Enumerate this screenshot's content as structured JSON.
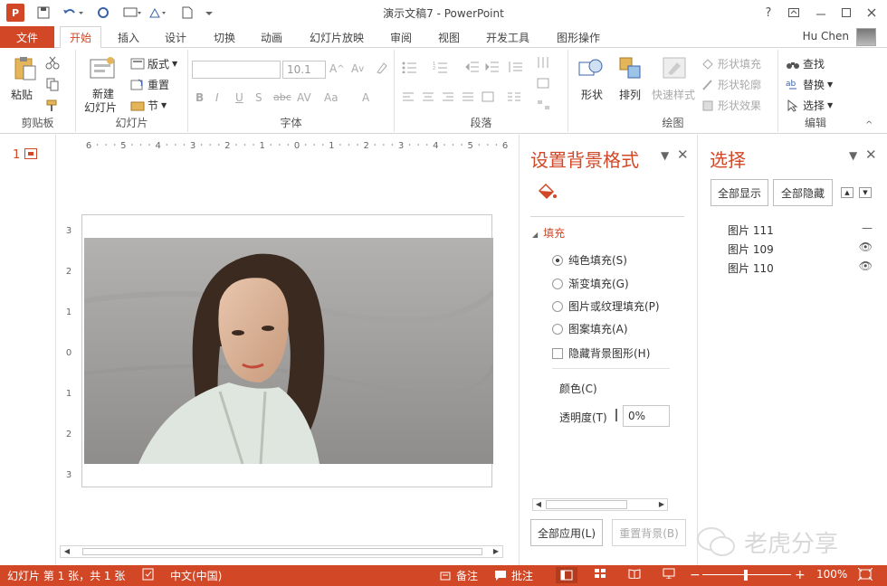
{
  "window": {
    "title": "演示文稿7 - PowerPoint",
    "app_logo": "P",
    "help": "?",
    "user_name": "Hu Chen"
  },
  "tabs": {
    "file": "文件",
    "items": [
      "开始",
      "插入",
      "设计",
      "切换",
      "动画",
      "幻灯片放映",
      "审阅",
      "视图",
      "开发工具",
      "图形操作"
    ],
    "active": "开始"
  },
  "ribbon": {
    "clipboard": {
      "label": "剪贴板",
      "paste": "粘贴"
    },
    "slides": {
      "label": "幻灯片",
      "new_slide_line1": "新建",
      "new_slide_line2": "幻灯片",
      "layout": "版式",
      "reset": "重置",
      "section": "节"
    },
    "font": {
      "label": "字体",
      "font_name": "",
      "font_size": "10.1"
    },
    "paragraph": {
      "label": "段落"
    },
    "drawing": {
      "label": "绘图",
      "shapes": "形状",
      "arrange": "排列",
      "quick_styles": "快速样式",
      "shape_fill": "形状填充",
      "shape_outline": "形状轮廓",
      "shape_effects": "形状效果"
    },
    "editing": {
      "label": "编辑",
      "find": "查找",
      "replace": "替换",
      "select": "选择"
    }
  },
  "thumbnails": {
    "slide_number": "1"
  },
  "ruler": {
    "h_marks": [
      "6",
      "5",
      "4",
      "3",
      "2",
      "1",
      "0",
      "1",
      "2",
      "3",
      "4",
      "5",
      "6"
    ],
    "v_marks": [
      "3",
      "2",
      "1",
      "0",
      "1",
      "2",
      "3"
    ]
  },
  "format_pane": {
    "title": "设置背景格式",
    "section": "填充",
    "options": [
      {
        "label": "纯色填充(S)",
        "selected": true
      },
      {
        "label": "渐变填充(G)",
        "selected": false
      },
      {
        "label": "图片或纹理填充(P)",
        "selected": false
      },
      {
        "label": "图案填充(A)",
        "selected": false
      }
    ],
    "hide_bg": "隐藏背景图形(H)",
    "color_label": "颜色(C)",
    "transparency_label": "透明度(T)",
    "transparency_value": "0%",
    "apply_all": "全部应用(L)",
    "reset_bg": "重置背景(B)"
  },
  "selection_pane": {
    "title": "选择",
    "show_all": "全部显示",
    "hide_all": "全部隐藏",
    "items": [
      {
        "name": "图片 111",
        "visibility": "—"
      },
      {
        "name": "图片 109",
        "visibility": "👁"
      },
      {
        "name": "图片 110",
        "visibility": "👁"
      }
    ]
  },
  "watermark": "老虎分享",
  "status": {
    "slide_info": "幻灯片 第 1 张，共 1 张",
    "language": "中文(中国)",
    "notes": "备注",
    "comments": "批注",
    "zoom": "100%"
  },
  "colors": {
    "accent": "#d24726"
  }
}
